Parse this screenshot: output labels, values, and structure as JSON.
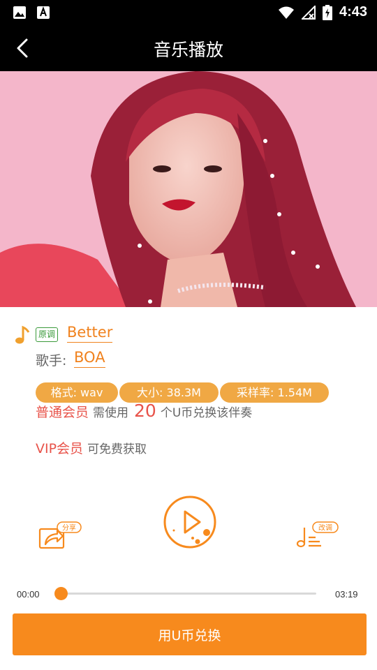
{
  "status_bar": {
    "time": "4:43"
  },
  "header": {
    "title": "音乐播放"
  },
  "song": {
    "key_tag": "原调",
    "name": "Better",
    "singer_label": "歌手:",
    "singer": "BOA"
  },
  "details": {
    "format": "格式: wav",
    "size": "大小: 38.3M",
    "sample_rate": "采样率: 1.54M"
  },
  "membership": {
    "normal_label": "普通会员",
    "normal_text_before": "需使用",
    "coin_count": "20",
    "normal_text_after": "个U币兑换该伴奏",
    "vip_label": "VIP会员",
    "vip_text": "可免费获取"
  },
  "controls": {
    "share_label": "分享",
    "tune_label": "改调"
  },
  "player": {
    "current_time": "00:00",
    "total_time": "03:19",
    "progress": 0.0
  },
  "action": {
    "exchange_label": "用U币兑换"
  },
  "colors": {
    "accent": "#f78a1d",
    "pill": "#f0a844",
    "member_red": "#e8534a",
    "key_green": "#3a9a3a"
  }
}
